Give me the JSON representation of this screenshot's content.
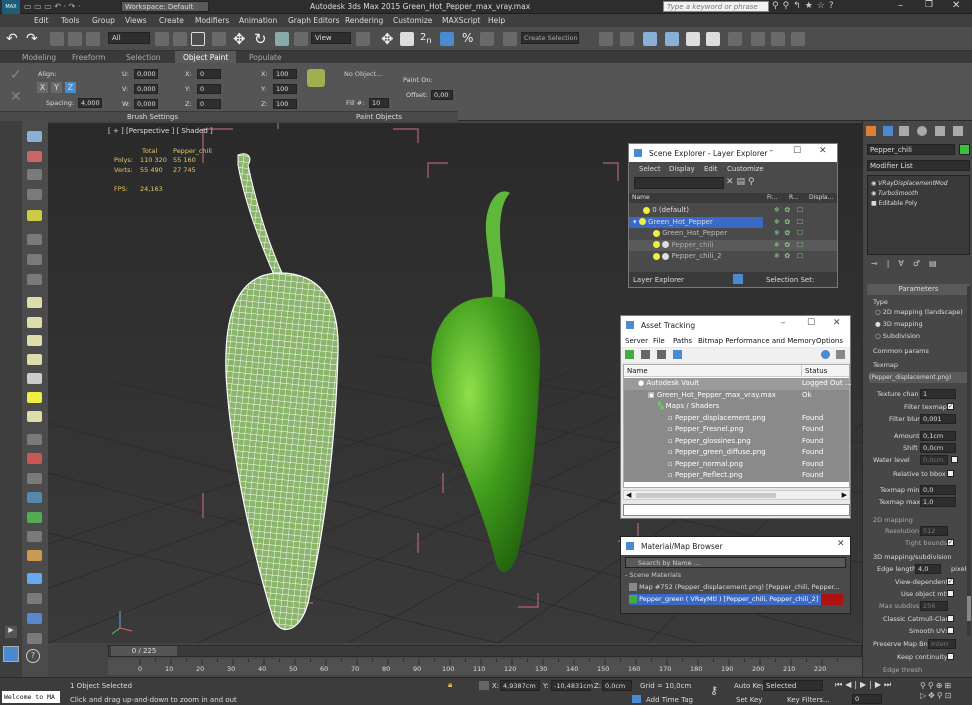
{
  "titlebar": {
    "workspace": "Workspace: Default",
    "title": "Autodesk 3ds Max  2015    Green_Hot_Pepper_max_vray.max",
    "search_placeholder": "Type a keyword or phrase"
  },
  "menu": [
    "Edit",
    "Tools",
    "Group",
    "Views",
    "Create",
    "Modifiers",
    "Animation",
    "Graph Editors",
    "Rendering",
    "Customize",
    "MAXScript",
    "Help"
  ],
  "toolbar": {
    "filter": "All",
    "view": "View",
    "selection_set": "Create Selection Se"
  },
  "ribbon_tabs": [
    "Modeling",
    "Freeform",
    "Selection",
    "Object Paint",
    "Populate"
  ],
  "ribbon": {
    "align_label": "Align:",
    "spacing_label": "Spacing:",
    "spacing_value": "4,000",
    "u_label": "U:",
    "u_value": "0,000",
    "v_label": "V:",
    "v_value": "0,000",
    "w_label": "W:",
    "w_value": "0,000",
    "x_label": "X:",
    "x_value": "0",
    "y_label": "Y:",
    "y_value": "0",
    "z_label": "Z:",
    "z_value": "0",
    "sx_label": "X:",
    "sx_value": "100",
    "sy_label": "Y:",
    "sy_value": "100",
    "sz_label": "Z:",
    "sz_value": "100",
    "no_object": "No Object...",
    "fill_label": "Fill #:",
    "fill_value": "10",
    "paint_on": "Paint On:",
    "offset_label": "Offset:",
    "offset_value": "0,00",
    "brush_settings": "Brush Settings",
    "paint_objects": "Paint Objects"
  },
  "viewport": {
    "label": "[ + ] [Perspective ] [ Shaded ]",
    "stats_headers": [
      "Total",
      "Pepper_chili"
    ],
    "polys_label": "Polys:",
    "polys_total": "110 320",
    "polys_sel": "55 160",
    "verts_label": "Verts:",
    "verts_total": "55 490",
    "verts_sel": "27 745",
    "fps_label": "FPS:",
    "fps_value": "24,163"
  },
  "scene_explorer": {
    "title": "Scene Explorer - Layer Explorer",
    "menu": [
      "Select",
      "Display",
      "Edit",
      "Customize"
    ],
    "columns": [
      "Name",
      "Fr...",
      "R...",
      "Displa..."
    ],
    "rows": [
      {
        "name": "0 (default)",
        "indent": 0,
        "selected": false
      },
      {
        "name": "Green_Hot_Pepper",
        "indent": 1,
        "selected": true
      },
      {
        "name": "Green_Hot_Pepper",
        "indent": 2,
        "selected": false
      },
      {
        "name": "Pepper_chili",
        "indent": 2,
        "selected": false
      },
      {
        "name": "Pepper_chili_2",
        "indent": 2,
        "selected": false
      }
    ],
    "footer_left": "Layer Explorer",
    "footer_right": "Selection Set:"
  },
  "asset_tracking": {
    "title": "Asset Tracking",
    "menu": [
      "Server",
      "File",
      "Paths",
      "Bitmap Performance and Memory",
      "Options"
    ],
    "columns": [
      "Name",
      "Status"
    ],
    "rows": [
      {
        "name": "Autodesk Vault",
        "status": "Logged Out ...",
        "indent": 0
      },
      {
        "name": "Green_Hot_Pepper_max_vray.max",
        "status": "Ok",
        "indent": 1
      },
      {
        "name": "Maps / Shaders",
        "status": "",
        "indent": 2
      },
      {
        "name": "Pepper_displacement.png",
        "status": "Found",
        "indent": 3
      },
      {
        "name": "Pepper_Fresnel.png",
        "status": "Found",
        "indent": 3
      },
      {
        "name": "Pepper_glossines.png",
        "status": "Found",
        "indent": 3
      },
      {
        "name": "Pepper_green_diffuse.png",
        "status": "Found",
        "indent": 3
      },
      {
        "name": "Pepper_normal.png",
        "status": "Found",
        "indent": 3
      },
      {
        "name": "Pepper_Reflect.png",
        "status": "Found",
        "indent": 3
      }
    ]
  },
  "material_browser": {
    "title": "Material/Map Browser",
    "search_placeholder": "Search by Name ...",
    "section": "- Scene Materials",
    "rows": [
      "Map #752 (Pepper_displacement.png) [Pepper_chili, Pepper...",
      "Pepper_green  ( VRayMtl ) [Pepper_chili, Pepper_chili_2]"
    ]
  },
  "command_panel": {
    "object_name": "Pepper_chili",
    "modifier_list": "Modifier List",
    "stack": [
      "VRayDisplacementMod",
      "TurboSmooth",
      "Editable Poly"
    ],
    "rollout": "Parameters",
    "type_label": "Type",
    "type_options": [
      "2D mapping (landscape)",
      "3D mapping",
      "Subdivision"
    ],
    "common_params": "Common params",
    "texmap_label": "Texmap",
    "texmap_value": "(Pepper_displacement.png)",
    "texture_chan_label": "Texture chan",
    "texture_chan_value": "1",
    "filter_texmap_label": "Filter texmap",
    "filter_blur_label": "Filter blur",
    "filter_blur_value": "0,001",
    "amount_label": "Amount",
    "amount_value": "0,1cm",
    "shift_label": "Shift",
    "shift_value": "0,0cm",
    "water_level_label": "Water level",
    "water_level_value": "0,0cm",
    "relative_bbox_label": "Relative to bbox",
    "texmap_min_label": "Texmap min",
    "texmap_min_value": "0,0",
    "texmap_max_label": "Texmap max",
    "texmap_max_value": "1,0",
    "mapping_2d": "2D mapping",
    "resolution_label": "Resolution",
    "resolution_value": "512",
    "tight_bounds_label": "Tight bounds",
    "mapping_3d": "3D mapping/subdivision",
    "edge_length_label": "Edge length",
    "edge_length_value": "4,0",
    "pixels_label": "pixels",
    "view_dependent_label": "View-dependent",
    "use_object_mtl_label": "Use object mtl",
    "max_subdivs_label": "Max subdivs",
    "max_subdivs_value": "256",
    "classic_catmull_label": "Classic Catmull-Clark",
    "smooth_uvs_label": "Smooth UVs",
    "preserve_map_bnd_label": "Preserve Map Bnd",
    "preserve_map_bnd_value": "Interr",
    "keep_continuity_label": "Keep continuity",
    "extra_levels_label": "Edge thresh"
  },
  "timeline": {
    "frame": "0 / 225",
    "ticks": [
      "0",
      "10",
      "20",
      "30",
      "40",
      "50",
      "60",
      "70",
      "80",
      "90",
      "100",
      "110",
      "120",
      "130",
      "140",
      "150",
      "160",
      "170",
      "180",
      "190",
      "200",
      "210",
      "220"
    ]
  },
  "status": {
    "maxscript": "Welcome to MA",
    "objects": "1 Object Selected",
    "prompt": "Click and drag up-and-down to zoom in and out",
    "x_label": "X:",
    "x_value": "4,9387cm",
    "y_label": "Y:",
    "y_value": "-10,4831cm",
    "z_label": "Z:",
    "z_value": "0,0cm",
    "grid": "Grid = 10,0cm",
    "add_time_tag": "Add Time Tag",
    "auto_key": "Auto Key",
    "selected": "Selected",
    "set_key": "Set Key",
    "key_filters": "Key Filters...",
    "frame_value": "0"
  },
  "colors": {
    "selection_blue": "#3a6ac5",
    "pepper_green": "#3f9a1c",
    "bbox_pink": "#d07080",
    "active_tab": "#5a5a5a"
  }
}
